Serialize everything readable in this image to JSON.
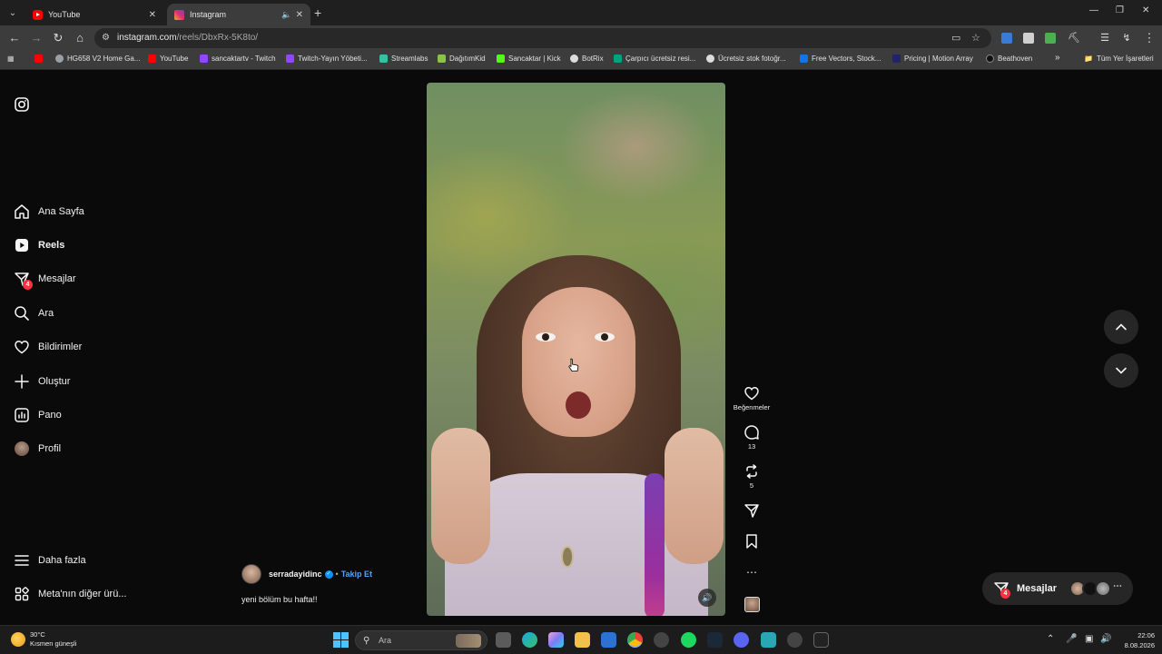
{
  "browser": {
    "tabs": [
      {
        "title": "YouTube",
        "favicon": "youtube-icon"
      },
      {
        "title": "Instagram",
        "favicon": "instagram-icon",
        "active": true
      }
    ],
    "url_host": "instagram.com",
    "url_path": "/reels/DbxRx-5K8to/",
    "bookmarks": [
      {
        "label": "",
        "icon": "youtube-icon",
        "color": "#ff0000"
      },
      {
        "label": "HG658 V2 Home Ga...",
        "icon": "globe-icon",
        "color": "#9aa0a6"
      },
      {
        "label": "YouTube",
        "icon": "youtube-icon",
        "color": "#ff0000"
      },
      {
        "label": "sancaktartv - Twitch",
        "icon": "twitch-icon",
        "color": "#9146ff"
      },
      {
        "label": "Twitch-Yayın Yöbeti...",
        "icon": "twitch-icon",
        "color": "#9146ff"
      },
      {
        "label": "Streamlabs",
        "icon": "streamlabs-icon",
        "color": "#31c3a2"
      },
      {
        "label": "DağıtımKid",
        "icon": "distrokid-icon",
        "color": "#8bc34a"
      },
      {
        "label": "Sancaktar | Kick",
        "icon": "kick-icon",
        "color": "#53fc18"
      },
      {
        "label": "BotRix",
        "icon": "botrix-icon",
        "color": "#dddddd"
      },
      {
        "label": "Çarpıcı ücretsiz resi...",
        "icon": "pexels-icon",
        "color": "#05a081"
      },
      {
        "label": "Ücretsiz stok fotoğr...",
        "icon": "pixabay-icon",
        "color": "#dddddd"
      },
      {
        "label": "Free Vectors, Stock...",
        "icon": "freepik-icon",
        "color": "#1273eb"
      },
      {
        "label": "Pricing | Motion Array",
        "icon": "motionarray-icon",
        "color": "#222266"
      },
      {
        "label": "Beathoven",
        "icon": "beathoven-icon",
        "color": "#111111"
      }
    ],
    "bookmarks_more": "»",
    "all_bookmarks": "Tüm Yer İşaretleri"
  },
  "sidebar": {
    "items": [
      {
        "label": "Ana Sayfa",
        "icon": "home-icon"
      },
      {
        "label": "Reels",
        "icon": "reels-icon",
        "active": true
      },
      {
        "label": "Mesajlar",
        "icon": "messages-icon",
        "badge": "4"
      },
      {
        "label": "Ara",
        "icon": "search-icon"
      },
      {
        "label": "Bildirimler",
        "icon": "heart-icon"
      },
      {
        "label": "Oluştur",
        "icon": "plus-icon"
      },
      {
        "label": "Pano",
        "icon": "dashboard-icon"
      },
      {
        "label": "Profil",
        "icon": "avatar"
      }
    ],
    "more": "Daha fazla",
    "meta": "Meta'nın diğer ürü..."
  },
  "reel": {
    "username": "serradayidinc",
    "follow": "Takip Et",
    "separator": "•",
    "caption": "yeni bölüm bu hafta!!",
    "likes_label": "Beğenmeler",
    "comments": "13",
    "reposts": "5"
  },
  "messages_pill": {
    "label": "Mesajlar",
    "badge": "4"
  },
  "taskbar": {
    "temperature": "30°C",
    "weather": "Kısmen güneşli",
    "search_placeholder": "Ara",
    "time": "22:06",
    "date": "8.08.2026"
  }
}
